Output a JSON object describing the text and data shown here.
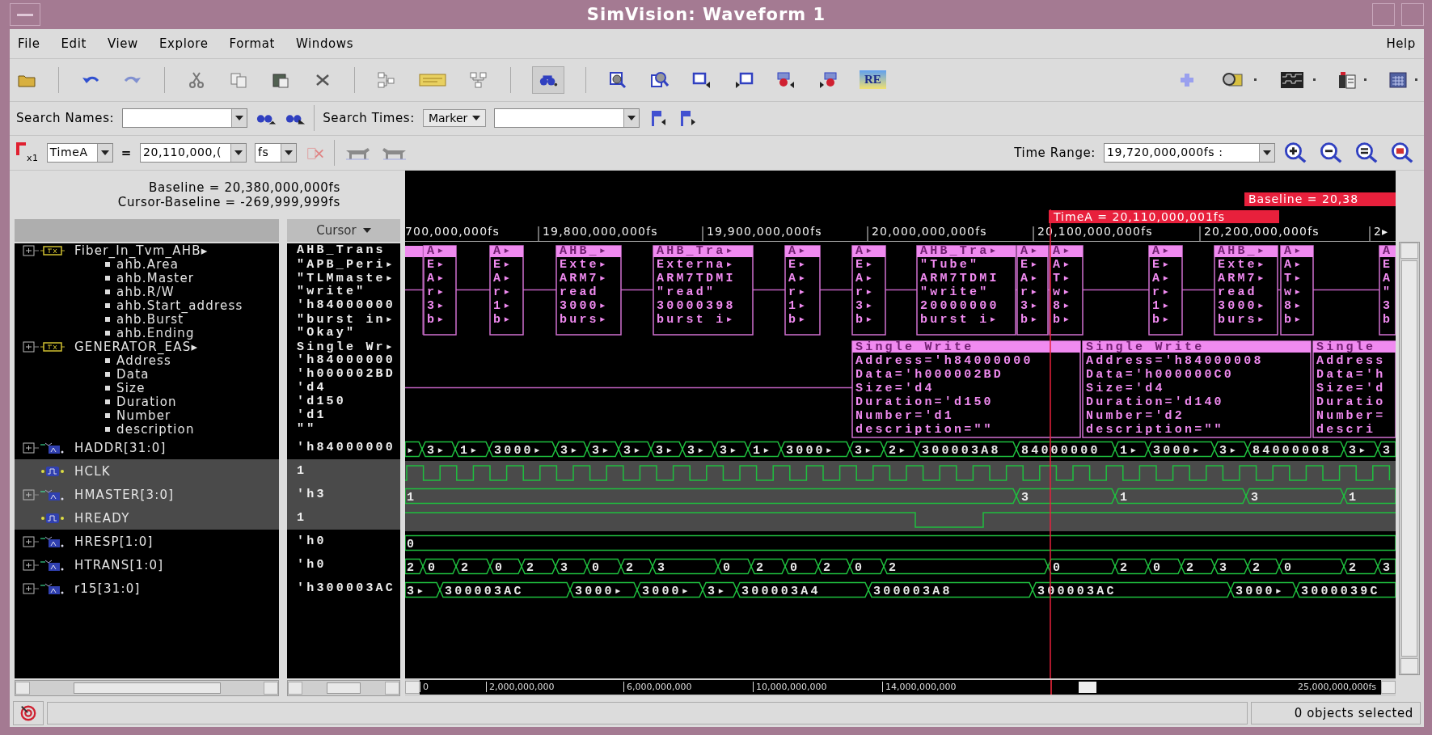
{
  "window": {
    "title": "SimVision: Waveform 1"
  },
  "menu": [
    "File",
    "Edit",
    "View",
    "Explore",
    "Format",
    "Windows"
  ],
  "help": "Help",
  "toolbar": {
    "badge": "RE"
  },
  "search": {
    "names_label": "Search Names:",
    "times_label": "Search Times:",
    "times_mode": "Marker"
  },
  "cursor_bar": {
    "marker_count": "x1",
    "marker": "TimeA",
    "equals": "=",
    "time": "20,110,000,(",
    "unit": "fs",
    "range_label": "Time Range:",
    "range": "19,720,000,000fs :"
  },
  "info": {
    "baseline": "Baseline = 20,380,000,000fs",
    "delta": "Cursor-Baseline = -269,999,999fs"
  },
  "value_header": "Cursor",
  "wave": {
    "baseline_label": "Baseline = 20,38",
    "cursor_label": "TimeA = 20,110,000,001fs",
    "ticks": [
      "700,000,000fs",
      "19,800,000,000fs",
      "19,900,000,000fs",
      "20,000,000,000fs",
      "20,100,000,000fs",
      "20,200,000,000fs",
      "2▸"
    ]
  },
  "groups": [
    {
      "name": "Fiber_In_Tvm_AHB▸",
      "value": "AHB_Trans",
      "fields": [
        {
          "name": "ahb.Area",
          "value": "\"APB_Peri▸"
        },
        {
          "name": "ahb.Master",
          "value": "\"TLMmaste▸"
        },
        {
          "name": "ahb.R/W",
          "value": "\"write\""
        },
        {
          "name": "ahb.Start_address",
          "value": "'h84000000"
        },
        {
          "name": "ahb.Burst",
          "value": "\"burst in▸"
        },
        {
          "name": "ahb.Ending",
          "value": "\"Okay\""
        }
      ],
      "transactions": [
        [
          "A▸",
          "E▸",
          "A▸",
          "r▸",
          "3▸",
          "b▸"
        ],
        [
          "A▸",
          "E▸",
          "A▸",
          "r▸",
          "1▸",
          "b▸"
        ],
        [
          "AHB_▸",
          "Exte▸",
          "ARM7▸",
          "read",
          "3000▸",
          "burs▸"
        ],
        [
          "AHB_Tra▸",
          "Externa▸",
          "ARM7TDMI",
          "\"read\"",
          "30000398",
          "burst i▸"
        ],
        [
          "A▸",
          "E▸",
          "A▸",
          "r▸",
          "1▸",
          "b▸"
        ],
        [
          "A▸",
          "E▸",
          "A▸",
          "r▸",
          "3▸",
          "b▸"
        ],
        [
          "AHB_Tra▸",
          "\"Tube\"",
          "ARM7TDMI",
          "\"write\"",
          "20000000",
          "burst i▸"
        ],
        [
          "A▸",
          "E▸",
          "A▸",
          "r▸",
          "3▸",
          "b▸"
        ],
        [
          "A▸",
          "A▸",
          "T▸",
          "w▸",
          "8▸",
          "b▸"
        ],
        [
          "A▸",
          "E▸",
          "A▸",
          "r▸",
          "1▸",
          "b▸"
        ],
        [
          "AHB_▸",
          "Exte▸",
          "ARM7▸",
          "read",
          "3000▸",
          "burs▸"
        ],
        [
          "A▸",
          "A▸",
          "T▸",
          "w▸",
          "8▸",
          "b▸"
        ],
        [
          "A",
          "E",
          "A",
          "\"",
          "3",
          "b"
        ]
      ]
    },
    {
      "name": "GENERATOR_EAS▸",
      "value": "Single Wr▸",
      "fields": [
        {
          "name": "Address",
          "value": "'h84000000"
        },
        {
          "name": "Data",
          "value": "'h000002BD"
        },
        {
          "name": "Size",
          "value": "'d4"
        },
        {
          "name": "Duration",
          "value": "'d150"
        },
        {
          "name": "Number",
          "value": "'d1"
        },
        {
          "name": "description",
          "value": "\"\""
        }
      ],
      "transactions": [
        [
          "Single Write",
          "Address='h84000000",
          "Data='h000002BD",
          "Size='d4",
          "Duration='d150",
          "Number='d1",
          "description=\"\""
        ],
        [
          "Single Write",
          "Address='h84000008",
          "Data='h000000C0",
          "Size='d4",
          "Duration='d140",
          "Number='d2",
          "description=\"\""
        ],
        [
          "Single ",
          "Address",
          "Data='h",
          "Size='d",
          "Duratio",
          "Number=",
          "descri"
        ]
      ]
    }
  ],
  "signals": [
    {
      "name": "HADDR[31:0]",
      "kind": "bus",
      "value": "'h84000000",
      "selected": false,
      "segments": [
        "▸",
        "3▸",
        "1▸",
        "3000▸",
        "3▸",
        "3▸",
        "3▸",
        "3▸",
        "3▸",
        "3▸",
        "1▸",
        "3000▸",
        "3▸",
        "2▸",
        "300003A8",
        "84000000",
        "1▸",
        "3000▸",
        "3▸",
        "84000008",
        "3▸",
        "3"
      ]
    },
    {
      "name": "HCLK",
      "kind": "clock",
      "value": "1",
      "selected": true
    },
    {
      "name": "HMASTER[3:0]",
      "kind": "bus",
      "value": "'h3",
      "selected": true,
      "segments": [
        "1",
        "3",
        "1",
        "3",
        "1"
      ]
    },
    {
      "name": "HREADY",
      "kind": "bit",
      "value": "1",
      "selected": true
    },
    {
      "name": "HRESP[1:0]",
      "kind": "bus",
      "value": "'h0",
      "selected": false,
      "segments": [
        "0"
      ]
    },
    {
      "name": "HTRANS[1:0]",
      "kind": "bus",
      "value": "'h0",
      "selected": false,
      "segments": [
        "2",
        "0",
        "2",
        "0",
        "2",
        "3",
        "0",
        "2",
        "3",
        "0",
        "2",
        "0",
        "2",
        "0",
        "2",
        "0",
        "2",
        "0",
        "2",
        "3",
        "2",
        "0",
        "2",
        "3"
      ]
    },
    {
      "name": "r15[31:0]",
      "kind": "bus",
      "value": "'h300003AC",
      "selected": false,
      "segments": [
        "3▸",
        "300003AC",
        "3000▸",
        "3000▸",
        "3▸",
        "300003A4",
        "300003A8",
        "300003AC",
        "3000▸",
        "3000039C"
      ]
    }
  ],
  "overview": {
    "ticks": [
      "0",
      "2,000,000,000",
      "6,000,000,000",
      "10,000,000,000",
      "14,000,000,000"
    ],
    "end": "25,000,000,000fs"
  },
  "status": "0 objects selected"
}
